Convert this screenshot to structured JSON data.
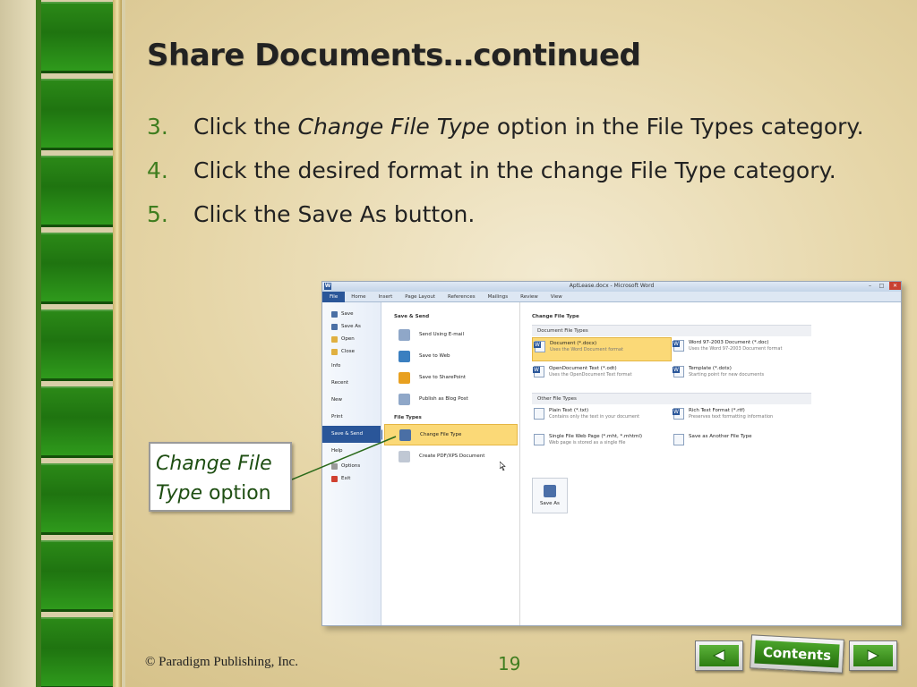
{
  "slide": {
    "title": "Share Documents…continued",
    "steps": [
      {
        "num": "3.",
        "pre": "Click the ",
        "em": "Change File Type",
        "post": " option in the File Types category."
      },
      {
        "num": "4.",
        "pre": "Click the desired format in the change File Type category.",
        "em": "",
        "post": ""
      },
      {
        "num": "5.",
        "pre": "Click the Save As button.",
        "em": "",
        "post": ""
      }
    ],
    "callout": {
      "em": "Change File Type",
      "plain": " option"
    },
    "footer_copyright": "© Paradigm Publishing, Inc.",
    "page_number": "19",
    "nav": {
      "contents_label": "Contents"
    }
  },
  "screenshot": {
    "window_title": "AptLease.docx - Microsoft Word",
    "app_icon": "W",
    "ribbon_tabs": [
      "File",
      "Home",
      "Insert",
      "Page Layout",
      "References",
      "Mailings",
      "Review",
      "View"
    ],
    "backstage_items": [
      {
        "label": "Save",
        "icon": "save-icon",
        "color": "#4a6fa5"
      },
      {
        "label": "Save As",
        "icon": "save-as-icon",
        "color": "#4a6fa5"
      },
      {
        "label": "Open",
        "icon": "folder-open-icon",
        "color": "#e0b040"
      },
      {
        "label": "Close",
        "icon": "folder-close-icon",
        "color": "#e0b040"
      },
      {
        "label": "Info",
        "icon": "",
        "color": ""
      },
      {
        "label": "Recent",
        "icon": "",
        "color": ""
      },
      {
        "label": "New",
        "icon": "",
        "color": ""
      },
      {
        "label": "Print",
        "icon": "",
        "color": ""
      },
      {
        "label": "Save & Send",
        "icon": "",
        "color": "",
        "selected": true
      },
      {
        "label": "Help",
        "icon": "",
        "color": ""
      },
      {
        "label": "Options",
        "icon": "options-icon",
        "color": "#999999"
      },
      {
        "label": "Exit",
        "icon": "exit-icon",
        "color": "#d04030"
      }
    ],
    "save_send": {
      "heading": "Save & Send",
      "items": [
        {
          "label": "Send Using E-mail",
          "icon": "email-icon",
          "color": "#8fa7c8"
        },
        {
          "label": "Save to Web",
          "icon": "globe-icon",
          "color": "#3a7fc0"
        },
        {
          "label": "Save to SharePoint",
          "icon": "sharepoint-icon",
          "color": "#e8a020"
        },
        {
          "label": "Publish as Blog Post",
          "icon": "blog-icon",
          "color": "#8fa7c8"
        }
      ],
      "file_types_heading": "File Types",
      "file_type_items": [
        {
          "label": "Change File Type",
          "icon": "change-file-type-icon",
          "color": "#4a6fa5",
          "selected": true
        },
        {
          "label": "Create PDF/XPS Document",
          "icon": "pdf-icon",
          "color": "#c0c8d4"
        }
      ]
    },
    "change_file_type": {
      "heading": "Change File Type",
      "document_group": "Document File Types",
      "document_types": [
        {
          "name": "Document (*.docx)",
          "desc": "Uses the Word Document format",
          "selected": true,
          "word": true
        },
        {
          "name": "Word 97-2003 Document (*.doc)",
          "desc": "Uses the Word 97-2003 Document format",
          "word": true
        },
        {
          "name": "OpenDocument Text (*.odt)",
          "desc": "Uses the OpenDocument Text format",
          "word": true
        },
        {
          "name": "Template (*.dotx)",
          "desc": "Starting point for new documents",
          "word": true
        }
      ],
      "other_group": "Other File Types",
      "other_types": [
        {
          "name": "Plain Text (*.txt)",
          "desc": "Contains only the text in your document"
        },
        {
          "name": "Rich Text Format (*.rtf)",
          "desc": "Preserves text formatting information",
          "word": true
        },
        {
          "name": "Single File Web Page (*.mht, *.mhtml)",
          "desc": "Web page is stored as a single file"
        },
        {
          "name": "Save as Another File Type",
          "desc": ""
        }
      ],
      "save_as_label": "Save As"
    }
  }
}
